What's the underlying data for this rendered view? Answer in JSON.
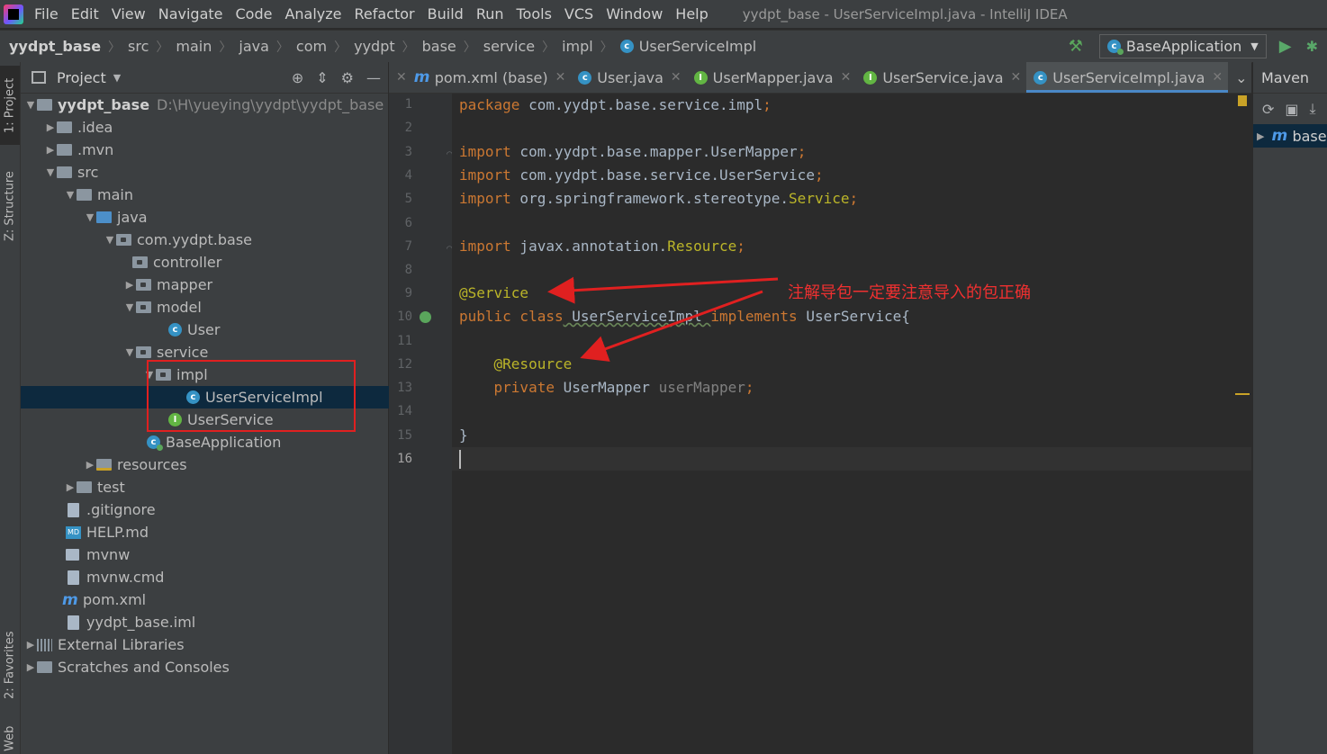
{
  "menu": {
    "items": [
      "File",
      "Edit",
      "View",
      "Navigate",
      "Code",
      "Analyze",
      "Refactor",
      "Build",
      "Run",
      "Tools",
      "VCS",
      "Window",
      "Help"
    ],
    "window_title": "yydpt_base - UserServiceImpl.java - IntelliJ IDEA"
  },
  "breadcrumb": {
    "project": "yydpt_base",
    "parts": [
      "src",
      "main",
      "java",
      "com",
      "yydpt",
      "base",
      "service",
      "impl"
    ],
    "current": "UserServiceImpl"
  },
  "run_config": {
    "label": "BaseApplication"
  },
  "left_strip": {
    "project_tab": "1: Project",
    "structure_tab": "Z: Structure",
    "favorites_tab": "2: Favorites",
    "web_tab": "Web"
  },
  "project_panel": {
    "title": "Project",
    "root_name": "yydpt_base",
    "root_path": "D:\\H\\yueying\\yydpt\\yydpt_base",
    "items": {
      "idea": ".idea",
      "mvn": ".mvn",
      "src": "src",
      "main": "main",
      "java": "java",
      "pkg": "com.yydpt.base",
      "controller": "controller",
      "mapper": "mapper",
      "model": "model",
      "user": "User",
      "service": "service",
      "impl": "impl",
      "impl_class": "UserServiceImpl",
      "user_service": "UserService",
      "base_app": "BaseApplication",
      "resources": "resources",
      "test": "test",
      "gitignore": ".gitignore",
      "help": "HELP.md",
      "mvnw": "mvnw",
      "mvnw_cmd": "mvnw.cmd",
      "pom": "pom.xml",
      "iml": "yydpt_base.iml",
      "ext_libs": "External Libraries",
      "scratches": "Scratches and Consoles"
    }
  },
  "tabs": [
    {
      "label": "pom.xml (base)",
      "icon": "maven-icon"
    },
    {
      "label": "User.java",
      "icon": "class-icon"
    },
    {
      "label": "UserMapper.java",
      "icon": "interface-icon"
    },
    {
      "label": "UserService.java",
      "icon": "interface-icon"
    },
    {
      "label": "UserServiceImpl.java",
      "icon": "class-icon",
      "active": true
    }
  ],
  "editor": {
    "line_numbers": [
      "1",
      "2",
      "3",
      "4",
      "5",
      "6",
      "7",
      "8",
      "9",
      "10",
      "11",
      "12",
      "13",
      "14",
      "15",
      "16"
    ],
    "code": {
      "l1_kw": "package",
      "l1_rest": " com.yydpt.base.service.impl",
      "l1_semi": ";",
      "l3_kw": "import",
      "l3_rest": " com.yydpt.base.mapper.UserMapper",
      "l3_semi": ";",
      "l4_kw": "import",
      "l4_rest": " com.yydpt.base.service.UserService",
      "l4_semi": ";",
      "l5_kw": "import",
      "l5_rest": " org.springframework.stereotype.",
      "l5_cls": "Service",
      "l5_semi": ";",
      "l7_kw": "import",
      "l7_rest": " javax.annotation.",
      "l7_cls": "Resource",
      "l7_semi": ";",
      "l9_ann": "@Service",
      "l10_kw": "public class",
      "l10_name": " UserServiceImpl ",
      "l10_kw2": "implements",
      "l10_rest": " UserService{",
      "l12_ann": "    @Resource",
      "l13_kw": "    private",
      "l13_type": " UserMapper ",
      "l13_field": "userMapper",
      "l13_semi": ";",
      "l15": "}"
    },
    "annotation_note": "注解导包一定要注意导入的包正确",
    "annotation_color": "#f03030"
  },
  "maven": {
    "title": "Maven",
    "project": "base"
  }
}
